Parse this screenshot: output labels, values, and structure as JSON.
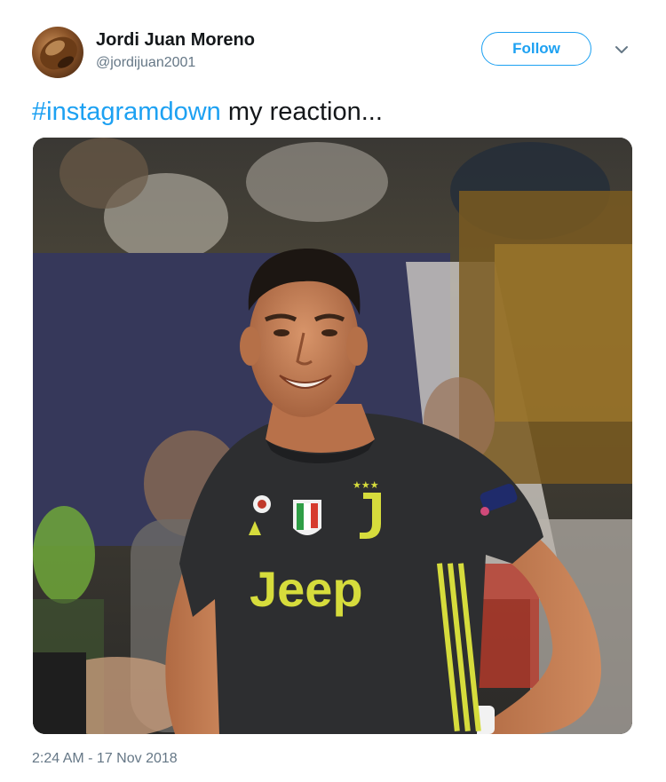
{
  "author": {
    "name": "Jordi Juan Moreno",
    "handle": "@jordijuan2001"
  },
  "follow_label": "Follow",
  "tweet": {
    "hashtag": "#instagramdown",
    "text": " my reaction..."
  },
  "media": {
    "jersey_text": "Jeep"
  },
  "timestamp": "2:24 AM - 17 Nov 2018",
  "colors": {
    "accent": "#1da1f2",
    "secondary_text": "#657786"
  }
}
